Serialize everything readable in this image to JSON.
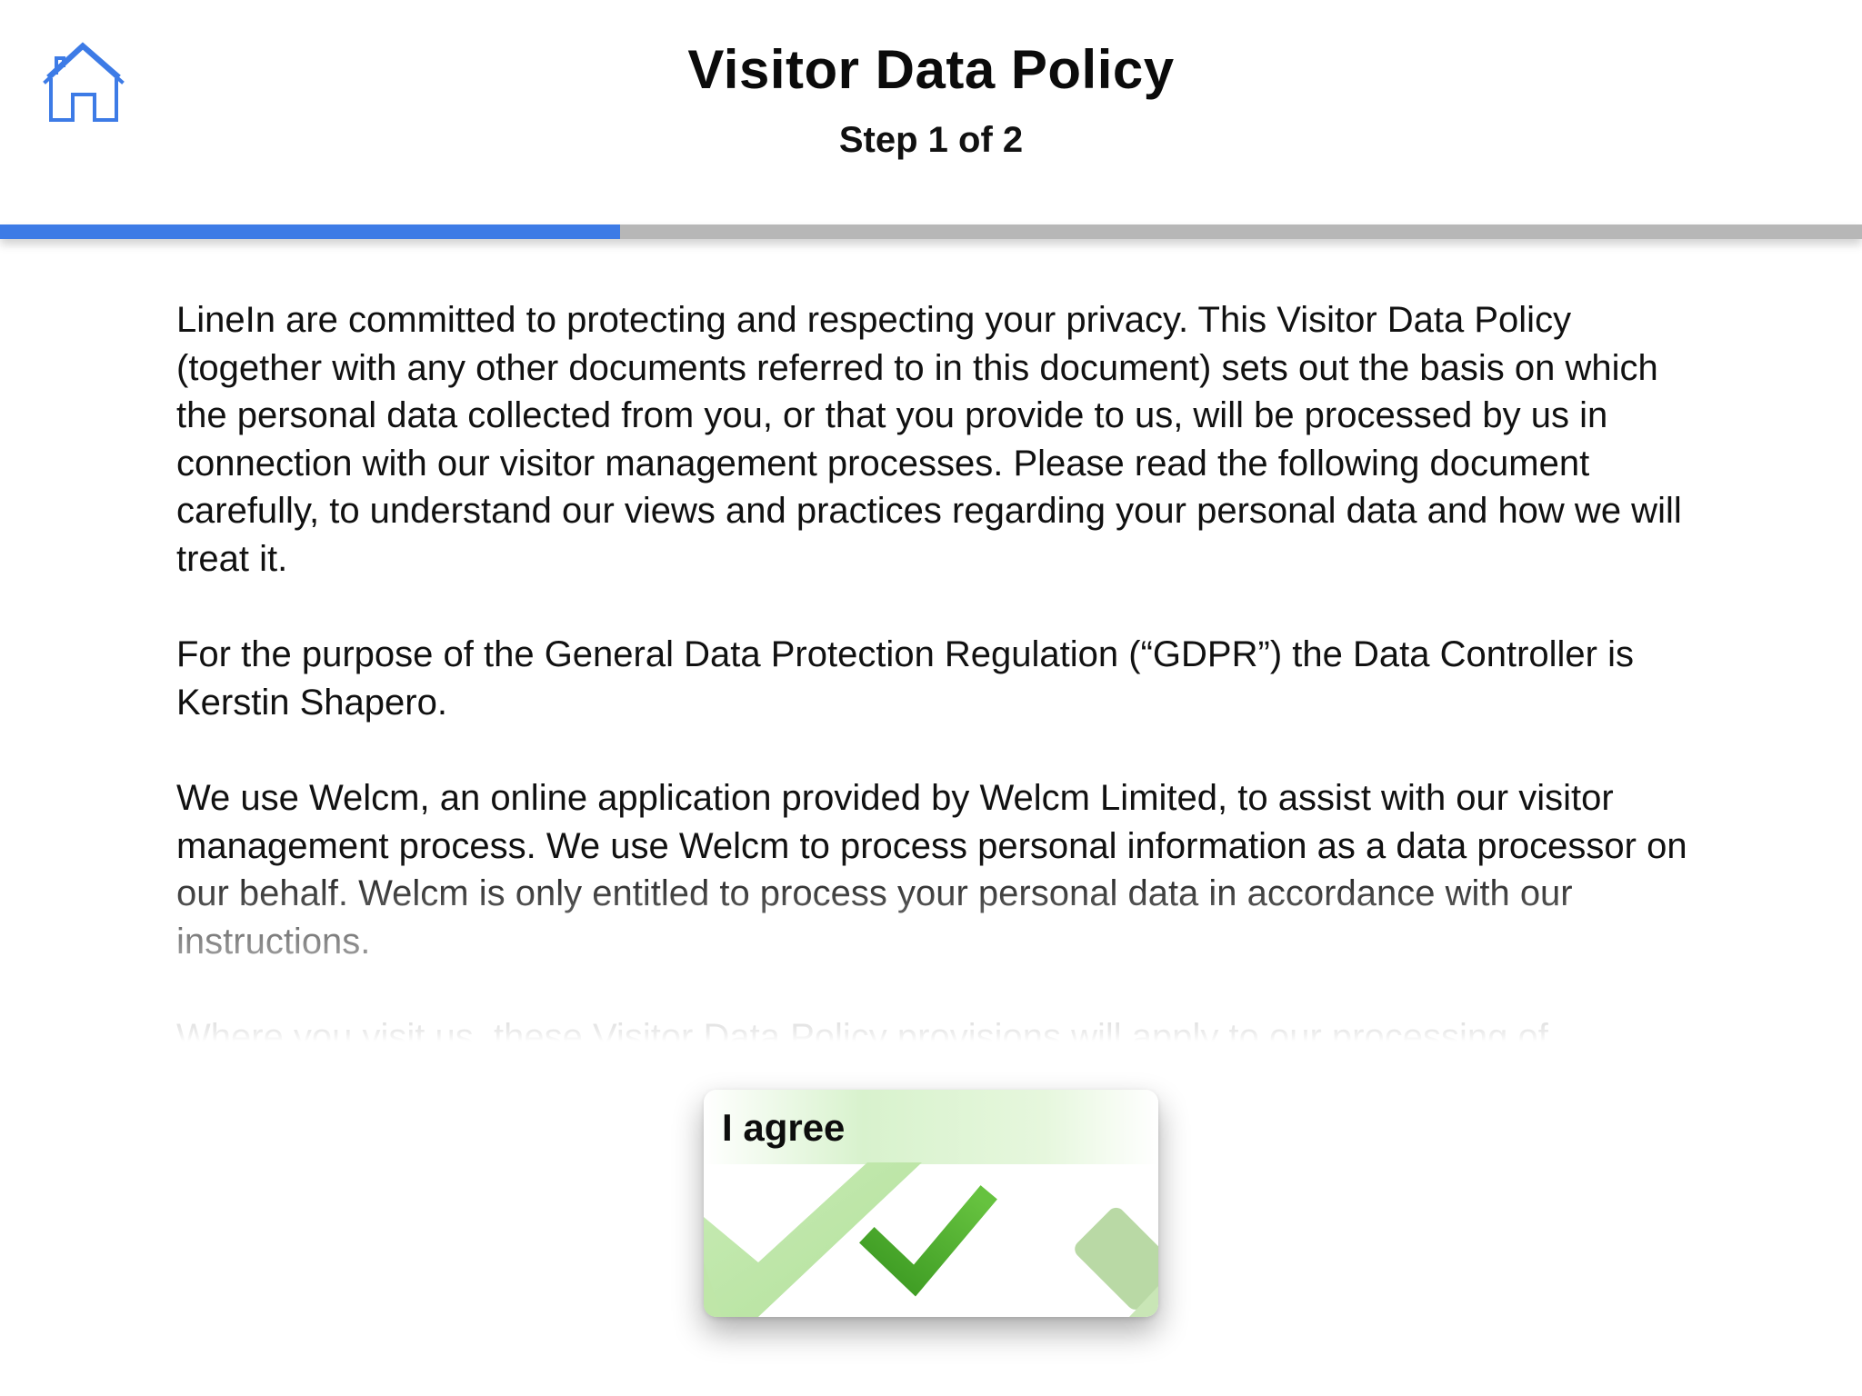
{
  "header": {
    "title": "Visitor Data Policy",
    "step": "Step 1 of 2",
    "home_icon": "home-icon"
  },
  "progress": {
    "fraction": 0.333,
    "fill_color": "#3d7be6",
    "track_color": "#b7b7b7"
  },
  "policy": {
    "paragraphs": [
      "LineIn are committed to protecting and respecting your privacy. This Visitor Data Policy (together with any other documents referred to in this document) sets out the basis on which the personal data collected from you, or that you provide to us, will be processed by us in connection with our visitor management processes. Please read the following document carefully, to understand our views and practices regarding your personal data and how we will treat it.",
      "For the purpose of the General Data Protection Regulation (“GDPR”) the Data Controller is Kerstin Shapero.",
      "We use Welcm, an online application provided by Welcm Limited, to assist with our visitor management process. We use Welcm to process personal information as a data processor on our behalf. Welcm is only entitled to process your personal data in accordance with our instructions.",
      "Where you visit us, these Visitor Data Policy provisions will apply to our processing of"
    ]
  },
  "agree_button": {
    "label": "I agree",
    "icon": "checkmark-icon",
    "accent_color": "#4aaa2a"
  }
}
